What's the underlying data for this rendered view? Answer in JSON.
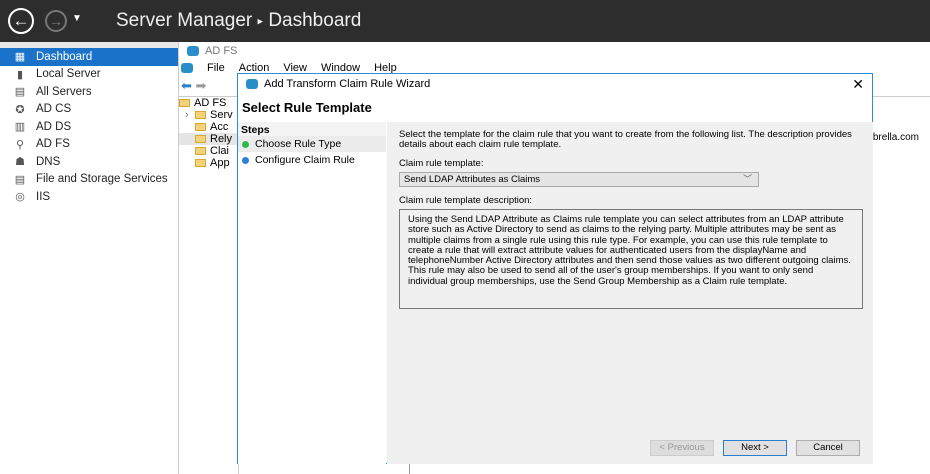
{
  "header": {
    "title": "Server Manager",
    "separator": "▸",
    "page": "Dashboard"
  },
  "sidebar": {
    "items": [
      {
        "label": "Dashboard",
        "icon": "dashboard-icon",
        "glyph": "▦",
        "selected": true
      },
      {
        "label": "Local Server",
        "icon": "server-icon",
        "glyph": "▮"
      },
      {
        "label": "All Servers",
        "icon": "servers-icon",
        "glyph": "▤"
      },
      {
        "label": "AD CS",
        "icon": "certificate-icon",
        "glyph": "✪"
      },
      {
        "label": "AD DS",
        "icon": "directory-icon",
        "glyph": "▥"
      },
      {
        "label": "AD FS",
        "icon": "federation-icon",
        "glyph": "⚲"
      },
      {
        "label": "DNS",
        "icon": "dns-icon",
        "glyph": "☗"
      },
      {
        "label": "File and Storage Services",
        "icon": "storage-icon",
        "glyph": "▤"
      },
      {
        "label": "IIS",
        "icon": "iis-icon",
        "glyph": "◎"
      }
    ]
  },
  "mmc": {
    "title": "AD FS",
    "menu": [
      "File",
      "Action",
      "View",
      "Window",
      "Help"
    ],
    "tree": [
      "AD FS",
      "Serv",
      "Acc",
      "Rely",
      "Clai",
      "App"
    ],
    "right_text": "brella.com"
  },
  "wizard": {
    "title": "Add Transform Claim Rule Wizard",
    "close": "✕",
    "header": "Select Rule Template",
    "steps_title": "Steps",
    "steps": [
      {
        "label": "Choose Rule Type",
        "color": "#2fb84a"
      },
      {
        "label": "Configure Claim Rule",
        "color": "#2a7fd8"
      }
    ],
    "intro": "Select the template for the claim rule that you want to create from the following list. The description provides details about each claim rule template.",
    "template_label": "Claim rule template:",
    "template_value": "Send LDAP Attributes as Claims",
    "description_label": "Claim rule template description:",
    "description": "Using the Send LDAP Attribute as Claims rule template you can select attributes from an LDAP attribute store such as Active Directory to send as claims to the relying party. Multiple attributes may be sent as multiple claims from a single rule using this rule type. For example, you can use this rule template to create a rule that will extract attribute values for authenticated users from the displayName and telephoneNumber Active Directory attributes and then send those values as two different outgoing claims. This rule may also be used to send all of the user's group memberships. If you want to only send individual group memberships, use the Send Group Membership as a Claim rule template.",
    "buttons": {
      "previous": "< Previous",
      "next": "Next >",
      "cancel": "Cancel"
    }
  }
}
